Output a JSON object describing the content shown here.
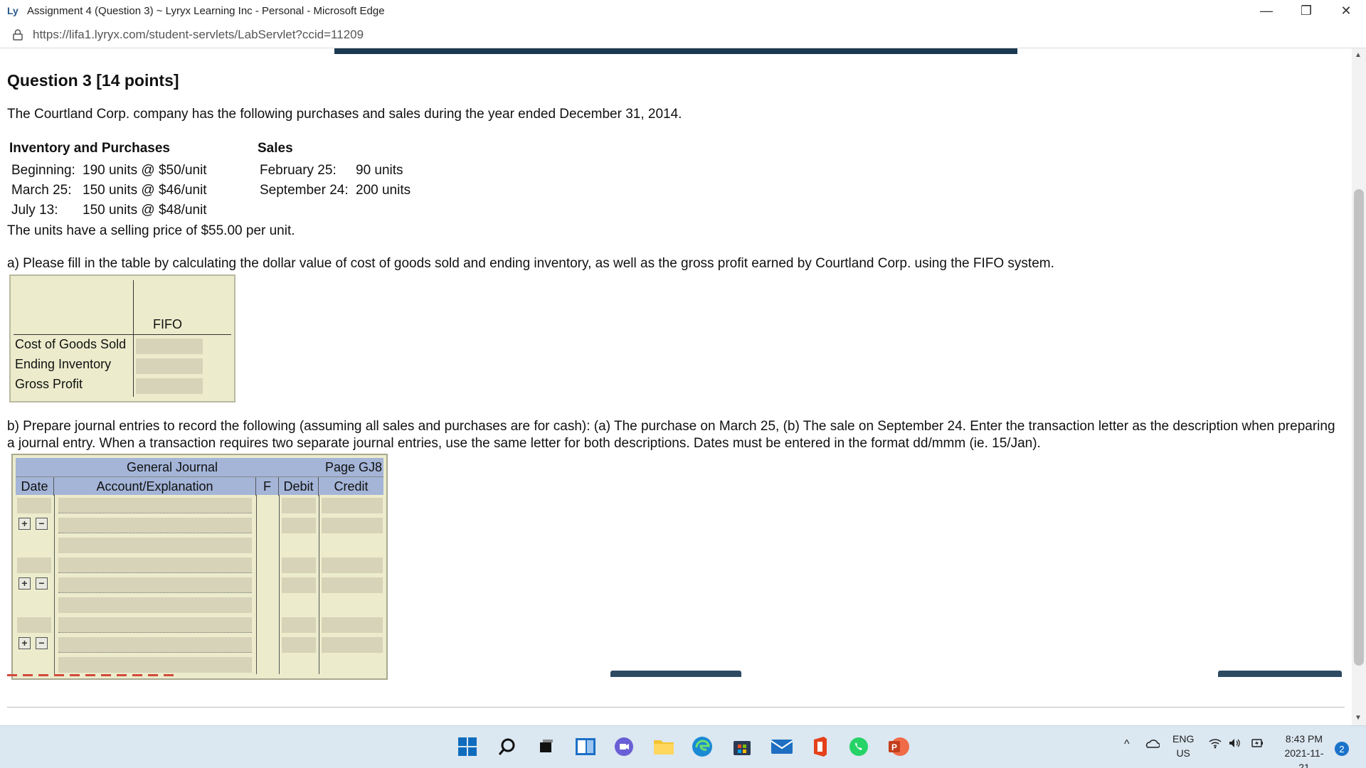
{
  "window": {
    "title": "Assignment 4 (Question 3) ~ Lyryx Learning Inc - Personal - Microsoft Edge",
    "minimize": "—",
    "restore": "❐",
    "close": "✕"
  },
  "address": {
    "url": "https://lifa1.lyryx.com/student-servlets/LabServlet?ccid=11209"
  },
  "question": {
    "title": "Question 3 [14 points]",
    "intro": "The Courtland Corp. company has the following purchases and sales during the year ended December 31, 2014.",
    "inventory_heading": "Inventory and Purchases",
    "sales_heading": "Sales",
    "purchases": [
      {
        "label": "Beginning:",
        "detail": "190 units @ $50/unit"
      },
      {
        "label": "March 25:",
        "detail": "150 units @ $46/unit"
      },
      {
        "label": "July 13:",
        "detail": "150 units @ $48/unit"
      }
    ],
    "sales": [
      {
        "label": "February 25:",
        "detail": "90 units"
      },
      {
        "label": "September 24:",
        "detail": "200 units"
      }
    ],
    "selling_price": "The units have a selling price of $55.00 per unit.",
    "part_a": "a) Please fill in the table by calculating the dollar value of cost of goods sold and ending inventory, as well as the gross profit earned by Courtland Corp. using the FIFO system.",
    "part_b": "b) Prepare journal entries to record the following (assuming all sales and purchases are for cash): (a) The purchase on March 25, (b) The sale on September 24. Enter the transaction letter as the description when preparing a journal entry. When a transaction requires two separate journal entries, use the same letter for both descriptions. Dates must be entered in the format dd/mmm (ie. 15/Jan)."
  },
  "fifo_table": {
    "column_header": "FIFO",
    "rows": [
      {
        "label": "Cost of Goods Sold",
        "value": ""
      },
      {
        "label": "Ending Inventory",
        "value": ""
      },
      {
        "label": "Gross Profit",
        "value": ""
      }
    ]
  },
  "journal": {
    "title": "General Journal",
    "page": "Page GJ8",
    "columns": [
      "Date",
      "Account/Explanation",
      "F",
      "Debit",
      "Credit"
    ],
    "plus": "+",
    "minus": "−"
  },
  "taskbar": {
    "lang_top": "ENG",
    "lang_bottom": "US",
    "time": "8:43 PM",
    "date": "2021-11-21",
    "notifications": "2",
    "icons": [
      "windows-start-icon",
      "search-icon",
      "task-view-icon",
      "widgets-icon",
      "teams-chat-icon",
      "file-explorer-icon",
      "edge-icon",
      "store-icon",
      "mail-icon",
      "office-icon",
      "whatsapp-icon",
      "powerpoint-icon"
    ]
  }
}
